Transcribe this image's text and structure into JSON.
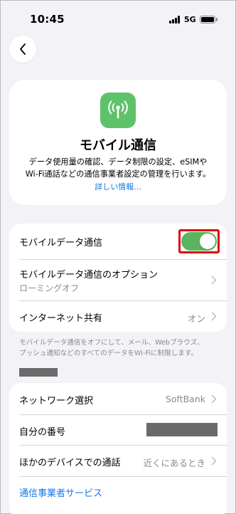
{
  "status_bar": {
    "time": "10:45",
    "network": "5G",
    "icons": [
      "signal-bars-icon",
      "battery-icon"
    ]
  },
  "nav": {
    "back_icon": "chevron-left-icon"
  },
  "header": {
    "icon": "cellular-antenna-icon",
    "icon_color": "#5ec26a",
    "title": "モバイル通信",
    "description_line1": "データ使用量の確認、データ制限の設定、eSIMや",
    "description_line2": "Wi-Fi通話などの通信事業者設定の管理を行います。",
    "link": "詳しい情報..."
  },
  "group1": {
    "mobile_data": {
      "label": "モバイルデータ通信",
      "enabled": true,
      "toggle_color": "#5bb55f",
      "highlight_color": "#e00010"
    },
    "mobile_data_options": {
      "label": "モバイルデータ通信のオプション",
      "sub": "ローミングオフ"
    },
    "hotspot": {
      "label": "インターネット共有",
      "value": "オン"
    }
  },
  "footnote": {
    "line1": "モバイルデータ通信をオフにして、メール、Webブラウズ、",
    "line2": "プッシュ通知などのすべてのデータをWi-Fiに制限します。"
  },
  "group2": {
    "network_selection": {
      "label": "ネットワーク選択",
      "value": "SoftBank"
    },
    "my_number": {
      "label": "自分の番号"
    },
    "calls_other_devices": {
      "label": "ほかのデバイスでの通話",
      "value": "近くにあるとき"
    },
    "carrier_services": {
      "label": "通信事業者サービス"
    }
  },
  "colors": {
    "accent": "#1677e6",
    "background": "#f2f2f7"
  }
}
